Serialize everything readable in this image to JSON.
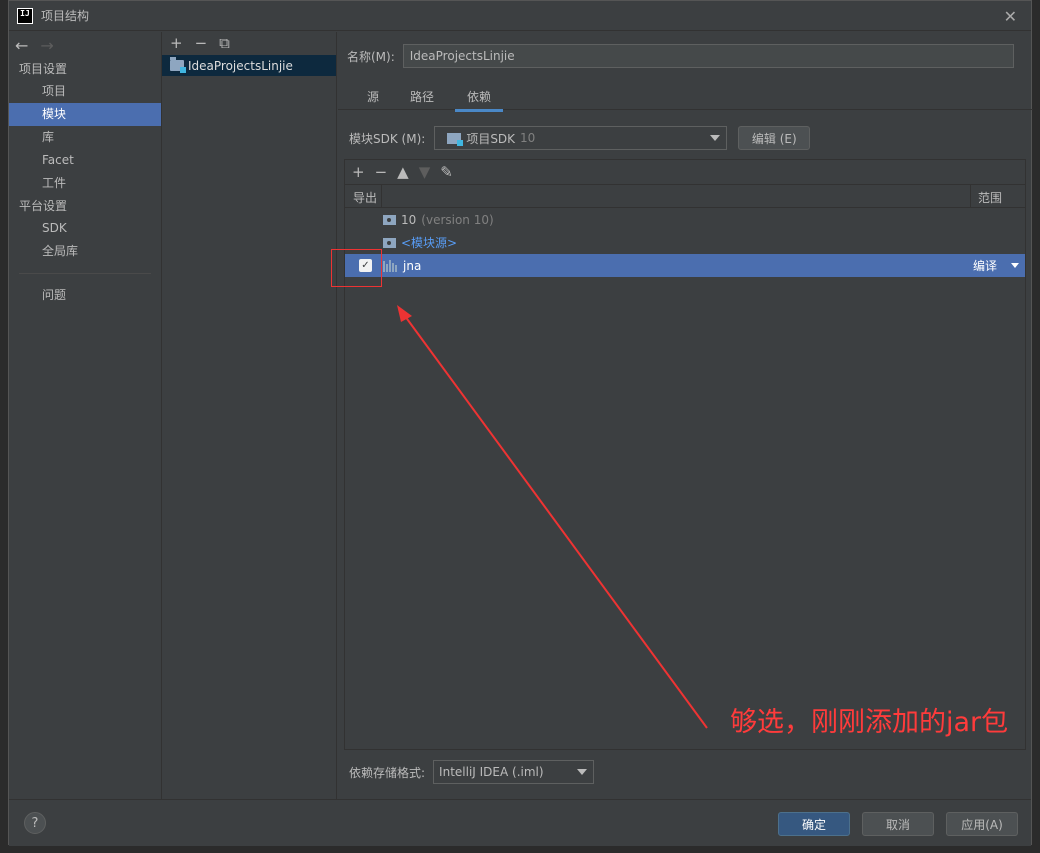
{
  "window": {
    "title": "项目结构",
    "app_icon_text": "IJ"
  },
  "nav": {
    "project_settings_header": "项目设置",
    "project_settings_items": [
      "项目",
      "模块",
      "库",
      "Facet",
      "工件"
    ],
    "platform_settings_header": "平台设置",
    "platform_settings_items": [
      "SDK",
      "全局库"
    ],
    "problems": "问题",
    "active_item": "模块"
  },
  "modules": {
    "items": [
      "IdeaProjectsLinjie"
    ]
  },
  "content": {
    "name_label": "名称(M):",
    "name_value": "IdeaProjectsLinjie",
    "tabs": [
      "源",
      "路径",
      "依赖"
    ],
    "active_tab": "依赖",
    "sdk_label": "模块SDK (M):",
    "sdk_value": "项目SDK",
    "sdk_version": "10",
    "edit_button": "编辑 (E)",
    "deps_columns": {
      "export": "导出",
      "scope": "范围"
    },
    "dependencies": [
      {
        "name": "10",
        "detail": "(version 10)",
        "kind": "sdk"
      },
      {
        "name": "<模块源>",
        "kind": "source"
      },
      {
        "name": "jna",
        "kind": "library",
        "exported": true,
        "scope": "编译",
        "selected": true
      }
    ],
    "format_label": "依赖存储格式:",
    "format_value": "IntelliJ IDEA (.iml)"
  },
  "footer": {
    "help": "?",
    "ok": "确定",
    "cancel": "取消",
    "apply": "应用(A)"
  },
  "annotation": {
    "text": "够选，刚刚添加的jar包",
    "color": "#ff3b3b"
  },
  "colors": {
    "selection": "#4b6eaf",
    "accent_tab": "#4a88c7",
    "background": "#3c3f41"
  }
}
